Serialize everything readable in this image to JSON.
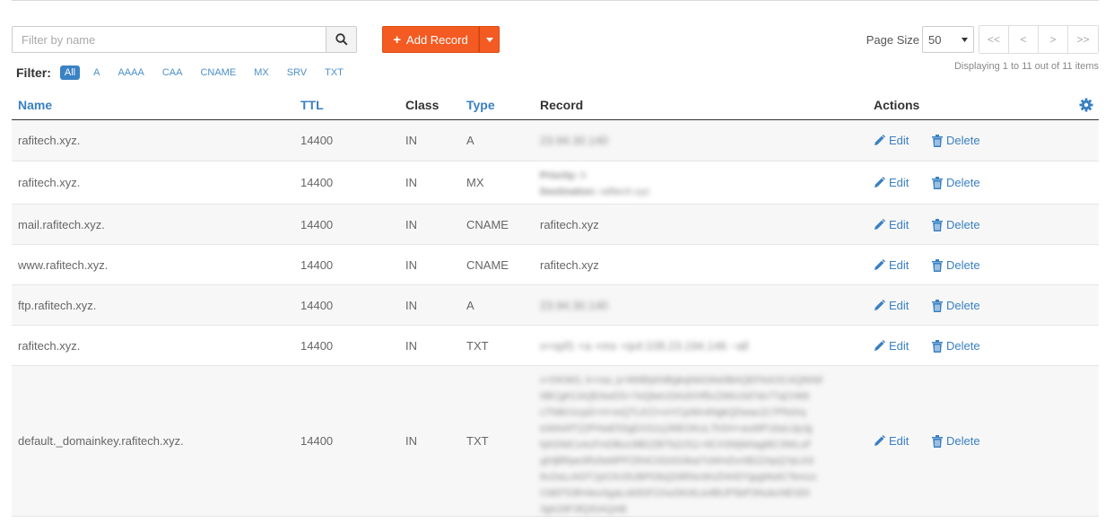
{
  "toolbar": {
    "search_placeholder": "Filter by name",
    "add_label": "Add Record",
    "page_size_label": "Page Size",
    "page_size_value": "50",
    "pager": [
      "<<",
      "<",
      ">",
      ">>"
    ],
    "display_info": "Displaying 1 to 11 out of 11 items"
  },
  "filter": {
    "label": "Filter:",
    "chips": [
      "All",
      "A",
      "AAAA",
      "CAA",
      "CNAME",
      "MX",
      "SRV",
      "TXT"
    ]
  },
  "table": {
    "headers": {
      "name": "Name",
      "ttl": "TTL",
      "class": "Class",
      "type": "Type",
      "record": "Record",
      "actions": "Actions"
    },
    "edit_label": "Edit",
    "delete_label": "Delete",
    "rows": [
      {
        "name": "rafitech.xyz.",
        "ttl": "14400",
        "class": "IN",
        "type": "A",
        "record": "23.94.30.140"
      },
      {
        "name": "rafitech.xyz.",
        "ttl": "14400",
        "class": "IN",
        "type": "MX",
        "record_priority_label": "Priority:",
        "record_priority": "0",
        "record_dest_label": "Destination:",
        "record_dest": "rafitech.xyz"
      },
      {
        "name": "mail.rafitech.xyz.",
        "ttl": "14400",
        "class": "IN",
        "type": "CNAME",
        "record": "rafitech.xyz"
      },
      {
        "name": "www.rafitech.xyz.",
        "ttl": "14400",
        "class": "IN",
        "type": "CNAME",
        "record": "rafitech.xyz"
      },
      {
        "name": "ftp.rafitech.xyz.",
        "ttl": "14400",
        "class": "IN",
        "type": "A",
        "record": "23.94.30.140"
      },
      {
        "name": "rafitech.xyz.",
        "ttl": "14400",
        "class": "IN",
        "type": "TXT",
        "record": "v=spf1 +a +mx +ip4:108.23.194.146 ~all"
      },
      {
        "name": "default._domainkey.rafitech.xyz.",
        "ttl": "14400",
        "class": "IN",
        "type": "TXT",
        "record_lines": [
          "v=DKIM1; k=rsa; p=MIIBIjANBgkqhkiG9w0BAQEFAAOCAQ8AM",
          "IIBCgKCAQEAwDS+7eQbeUGKdXHf5cZIMrz3d7dv77qCH66",
          "c7h8kVzcpD+H+ioQTLKCl+mYCpWn4NgkQDwacZc7Pfo0rq",
          "tcMAAfT22PHwE5SgDXS1rjJ9IEOKuL7hSH+wuMP16aUJpJg",
          "fyKDMCxAcFmDBuU8B2ZBTbZcf11+9CX3WjWIag8tC3WLuF",
          "yjHjBRpe3RzfwMPPZR4C0G0G0kai7oWmDvXB2ZApQYpLK6",
          "6vZwLrA0ITJyICKn5UBPD8zjS9RNcWvZHHDYjpgMoiiCTemzx",
          "CbEF53fH4exAgaLob5DF2XwSKt4Lw4BUP5bP3NubcNESDI",
          "3gh29F3fQIDAQAB"
        ]
      }
    ]
  }
}
